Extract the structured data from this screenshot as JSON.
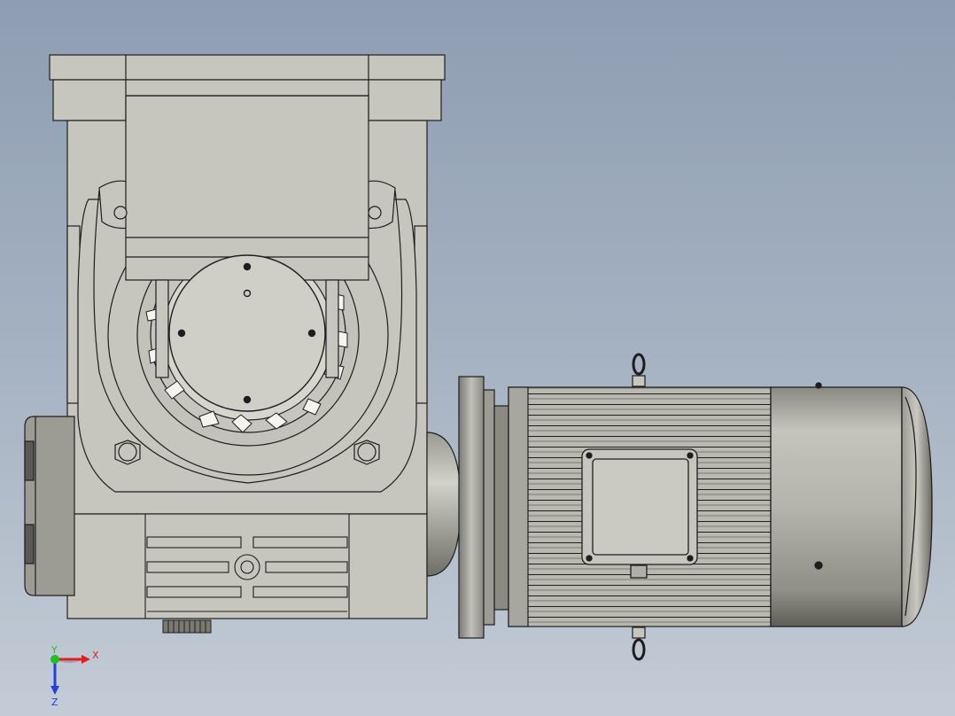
{
  "viewport": {
    "background_top": "#8e9db2",
    "background_bottom": "#c3ccd6",
    "part_fill": "#c6c6bf",
    "part_fill_light": "#d4d4cd",
    "part_fill_dark": "#a6a69f",
    "edge_color": "#1e1e1e",
    "motor_shadow": "#5f5f58"
  },
  "triad": {
    "x_label": "X",
    "y_label": "Y",
    "z_label": "Z",
    "x_color": "#e02020",
    "y_color": "#20c020",
    "z_color": "#2040e0"
  }
}
